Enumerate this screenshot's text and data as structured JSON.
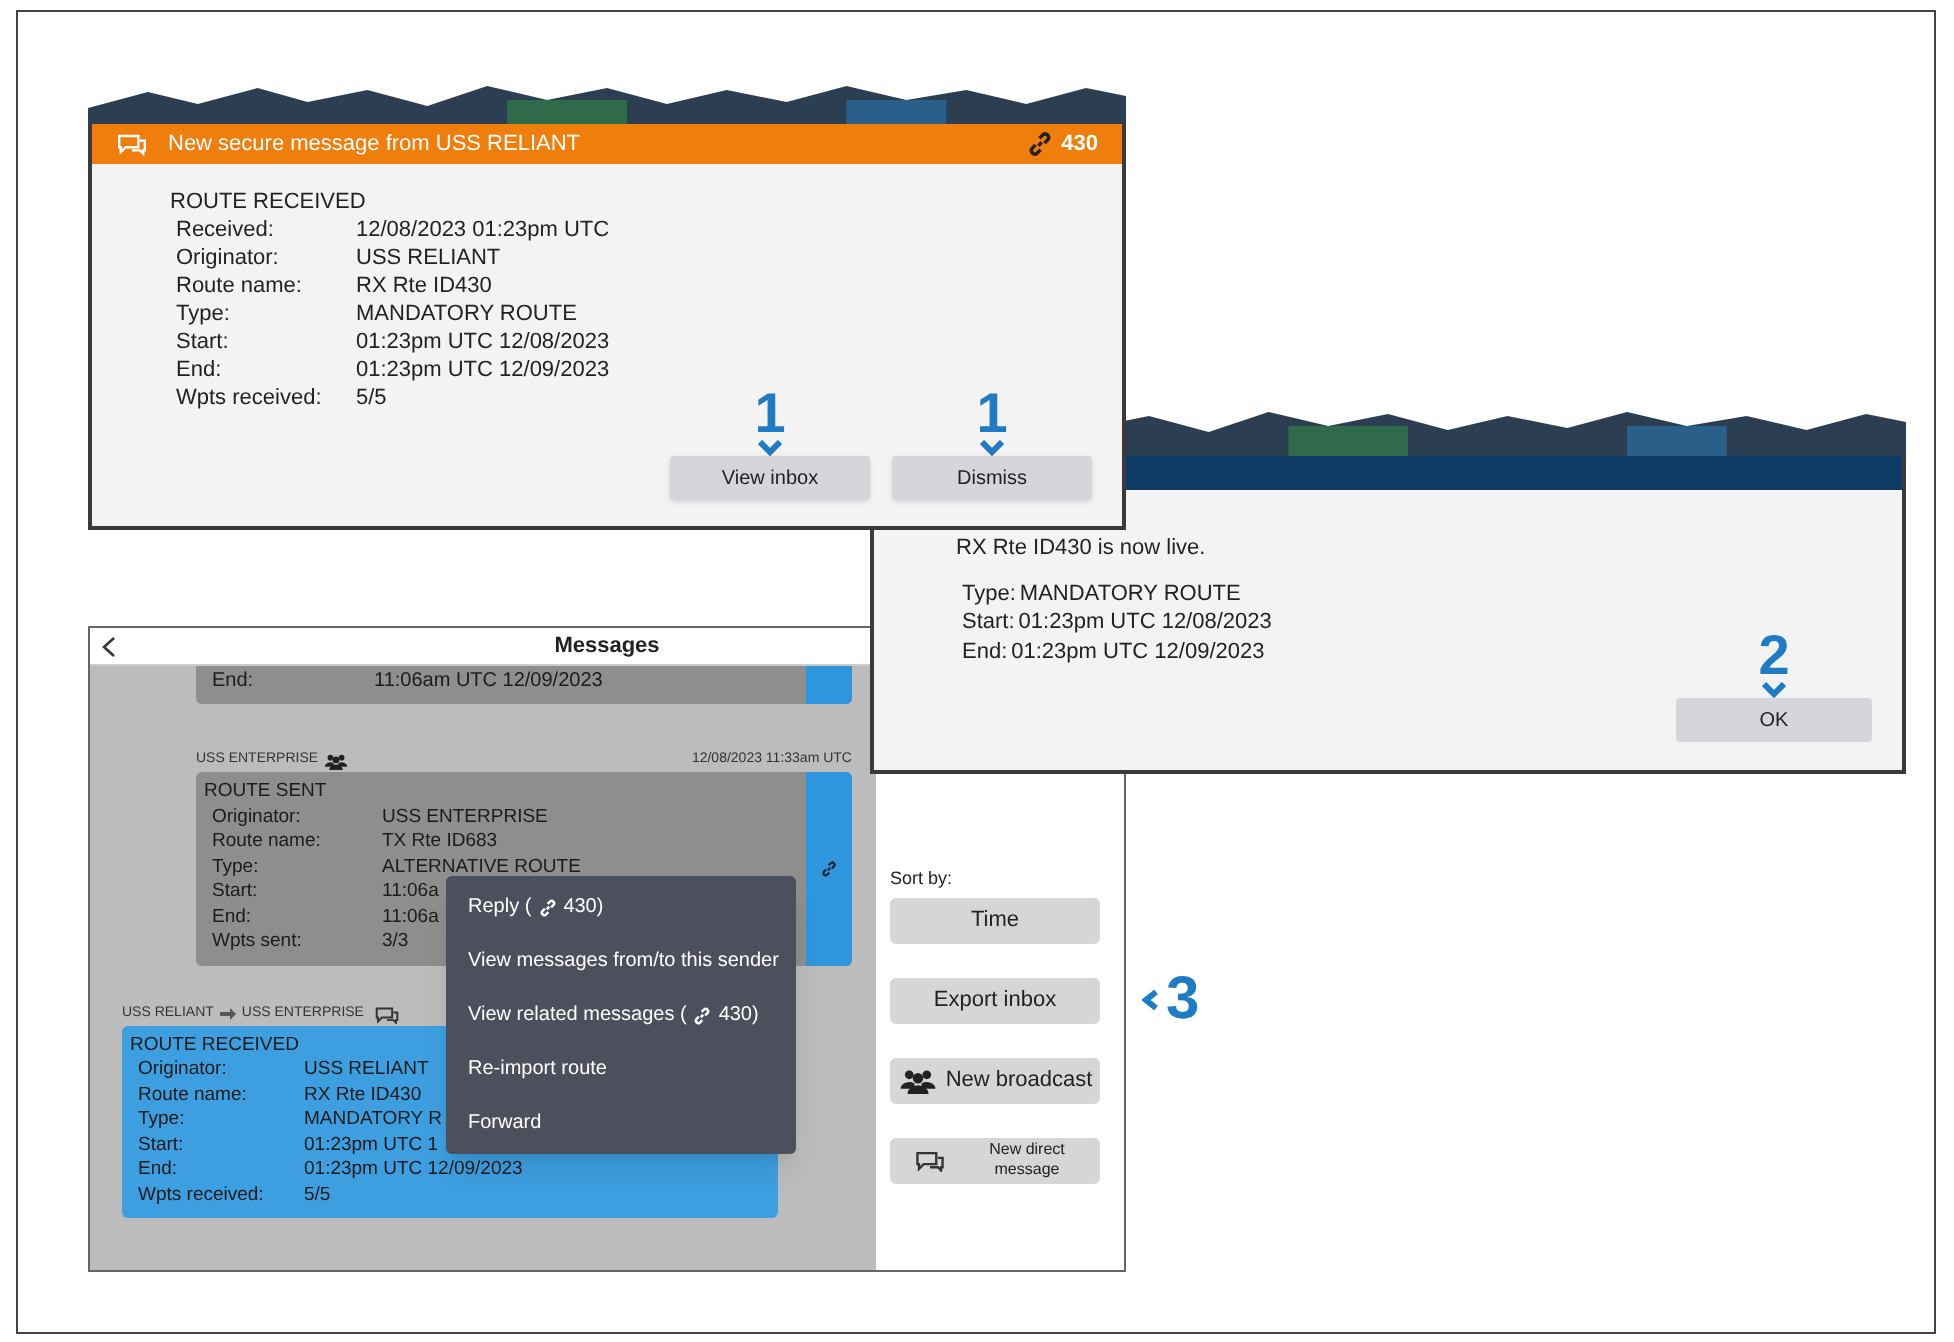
{
  "notification": {
    "title": "New secure message from USS RELIANT",
    "link_count": "430",
    "heading": "ROUTE RECEIVED",
    "fields": [
      {
        "label": "Received:",
        "value": "12/08/2023 01:23pm UTC"
      },
      {
        "label": "Originator:",
        "value": "USS RELIANT"
      },
      {
        "label": "Route name:",
        "value": "RX Rte ID430"
      },
      {
        "label": "Type:",
        "value": "MANDATORY ROUTE"
      },
      {
        "label": "Start:",
        "value": "01:23pm UTC 12/08/2023"
      },
      {
        "label": "End:",
        "value": "01:23pm UTC 12/09/2023"
      },
      {
        "label": "Wpts received:",
        "value": "5/5"
      }
    ],
    "buttons": [
      {
        "label": "View inbox",
        "callout": "1"
      },
      {
        "label": "Dismiss",
        "callout": "1"
      }
    ]
  },
  "confirmation": {
    "message": "RX Rte ID430 is now live.",
    "fields": [
      {
        "label": "Type:",
        "value": "MANDATORY ROUTE"
      },
      {
        "label": "Start:",
        "value": "01:23pm UTC 12/08/2023"
      },
      {
        "label": "End:",
        "value": "01:23pm UTC 12/09/2023"
      }
    ],
    "button": {
      "label": "OK",
      "callout": "2"
    }
  },
  "messages": {
    "title": "Messages",
    "partial_card": {
      "label": "End:",
      "value": "11:06am UTC 12/09/2023"
    },
    "threads": [
      {
        "kind": "broadcast",
        "sender": "USS ENTERPRISE",
        "time": "12/08/2023 11:33am UTC",
        "heading": "ROUTE SENT",
        "selected": false,
        "fields": [
          {
            "label": "Originator:",
            "value": "USS ENTERPRISE"
          },
          {
            "label": "Route name:",
            "value": "TX Rte ID683"
          },
          {
            "label": "Type:",
            "value": "ALTERNATIVE ROUTE"
          },
          {
            "label": "Start:",
            "value": "11:06a"
          },
          {
            "label": "End:",
            "value": "11:06a"
          },
          {
            "label": "Wpts sent:",
            "value": "3/3"
          }
        ]
      },
      {
        "kind": "direct",
        "sender": "USS RELIANT",
        "recipient": "USS ENTERPRISE",
        "heading": "ROUTE RECEIVED",
        "selected": true,
        "fields": [
          {
            "label": "Originator:",
            "value": "USS RELIANT"
          },
          {
            "label": "Route name:",
            "value": "RX Rte ID430"
          },
          {
            "label": "Type:",
            "value": "MANDATORY R"
          },
          {
            "label": "Start:",
            "value": "01:23pm UTC 1"
          },
          {
            "label": "End:",
            "value": "01:23pm UTC 12/09/2023"
          },
          {
            "label": "Wpts received:",
            "value": "5/5"
          }
        ]
      }
    ],
    "context_menu": [
      {
        "prefix": "Reply (",
        "suffix": "430)",
        "link": true
      },
      {
        "prefix": "View messages from/to this sender",
        "link": false
      },
      {
        "prefix": "View related messages (",
        "suffix": "430)",
        "link": true
      },
      {
        "prefix": "Re-import route",
        "link": false
      },
      {
        "prefix": "Forward",
        "link": false
      }
    ],
    "sidebar": {
      "sort_label": "Sort by:",
      "buttons": [
        {
          "kind": "plain",
          "label": "Time"
        },
        {
          "kind": "plain",
          "label": "Export inbox",
          "callout": "3"
        },
        {
          "kind": "broadcast",
          "label": "New broadcast"
        },
        {
          "kind": "direct",
          "label": "New direct message"
        }
      ]
    }
  }
}
